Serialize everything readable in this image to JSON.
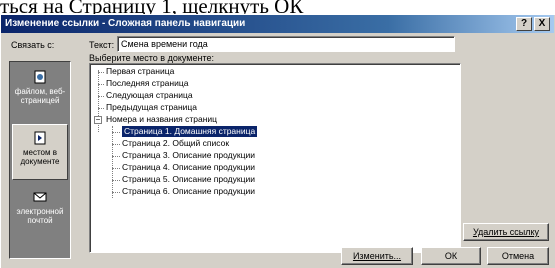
{
  "caption": "ться на Страницу 1, щелкнуть ОК",
  "dialog": {
    "title": "Изменение ссылки - Сложная панель навигации",
    "help_label": "?",
    "close_label": "X",
    "link_to_label": "Связать с:",
    "text_label": "Текст:",
    "text_value": "Смена времени года",
    "choose_label": "Выберите место в документе:"
  },
  "leftbar": {
    "items": [
      {
        "label": "файлом, веб-страницей",
        "icon": "web-page-icon"
      },
      {
        "label": "местом в документе",
        "icon": "document-place-icon"
      },
      {
        "label": "электронной почтой",
        "icon": "email-icon"
      }
    ]
  },
  "tree": {
    "first": "Первая страница",
    "last": "Последняя страница",
    "next": "Следующая страница",
    "prev": "Предыдущая страница",
    "group": "Номера и названия страниц",
    "pages": [
      "Страница 1. Домашняя страница",
      "Страница 2. Общий список",
      "Страница 3. Описание продукции",
      "Страница 4. Описание продукции",
      "Страница 5. Описание продукции",
      "Страница 6. Описание продукции"
    ]
  },
  "buttons": {
    "remove_link": "Удалить ссылку",
    "change": "Изменить...",
    "ok": "ОК",
    "cancel": "Отмена"
  }
}
